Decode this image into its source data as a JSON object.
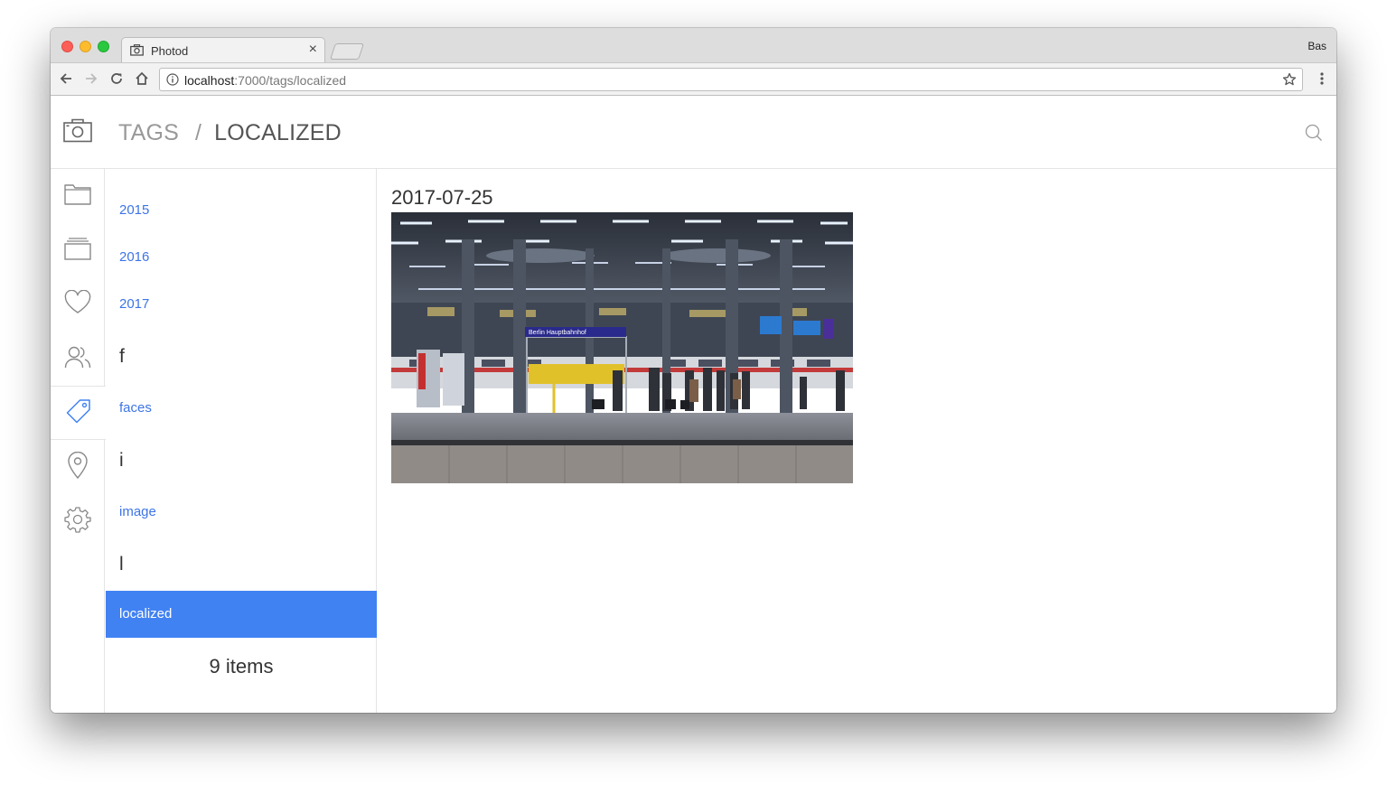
{
  "browser": {
    "tab_title": "Photod",
    "tab_close": "×",
    "profile_name": "Bas",
    "url_host": "localhost",
    "url_rest": ":7000/tags/localized"
  },
  "header": {
    "crumb_root": "TAGS",
    "crumb_separator": "/",
    "crumb_current": "LOCALIZED"
  },
  "sidebar": {
    "icons": [
      "folder-icon",
      "albums-icon",
      "heart-icon",
      "people-icon",
      "tag-icon",
      "location-icon",
      "settings-icon"
    ],
    "active": "tag-icon"
  },
  "tags": {
    "entries": [
      {
        "type": "link",
        "label": "2015"
      },
      {
        "type": "link",
        "label": "2016"
      },
      {
        "type": "link",
        "label": "2017"
      },
      {
        "type": "letter",
        "label": "f"
      },
      {
        "type": "link",
        "label": "faces"
      },
      {
        "type": "letter",
        "label": "i"
      },
      {
        "type": "link",
        "label": "image"
      },
      {
        "type": "letter",
        "label": "l"
      },
      {
        "type": "selected",
        "label": "localized"
      }
    ],
    "count_label": "9 items"
  },
  "content": {
    "date_heading": "2017-07-25",
    "photo_sign": "Berlin Hauptbahnhof"
  },
  "colors": {
    "accent": "#4182f3",
    "link": "#3d74e6"
  }
}
